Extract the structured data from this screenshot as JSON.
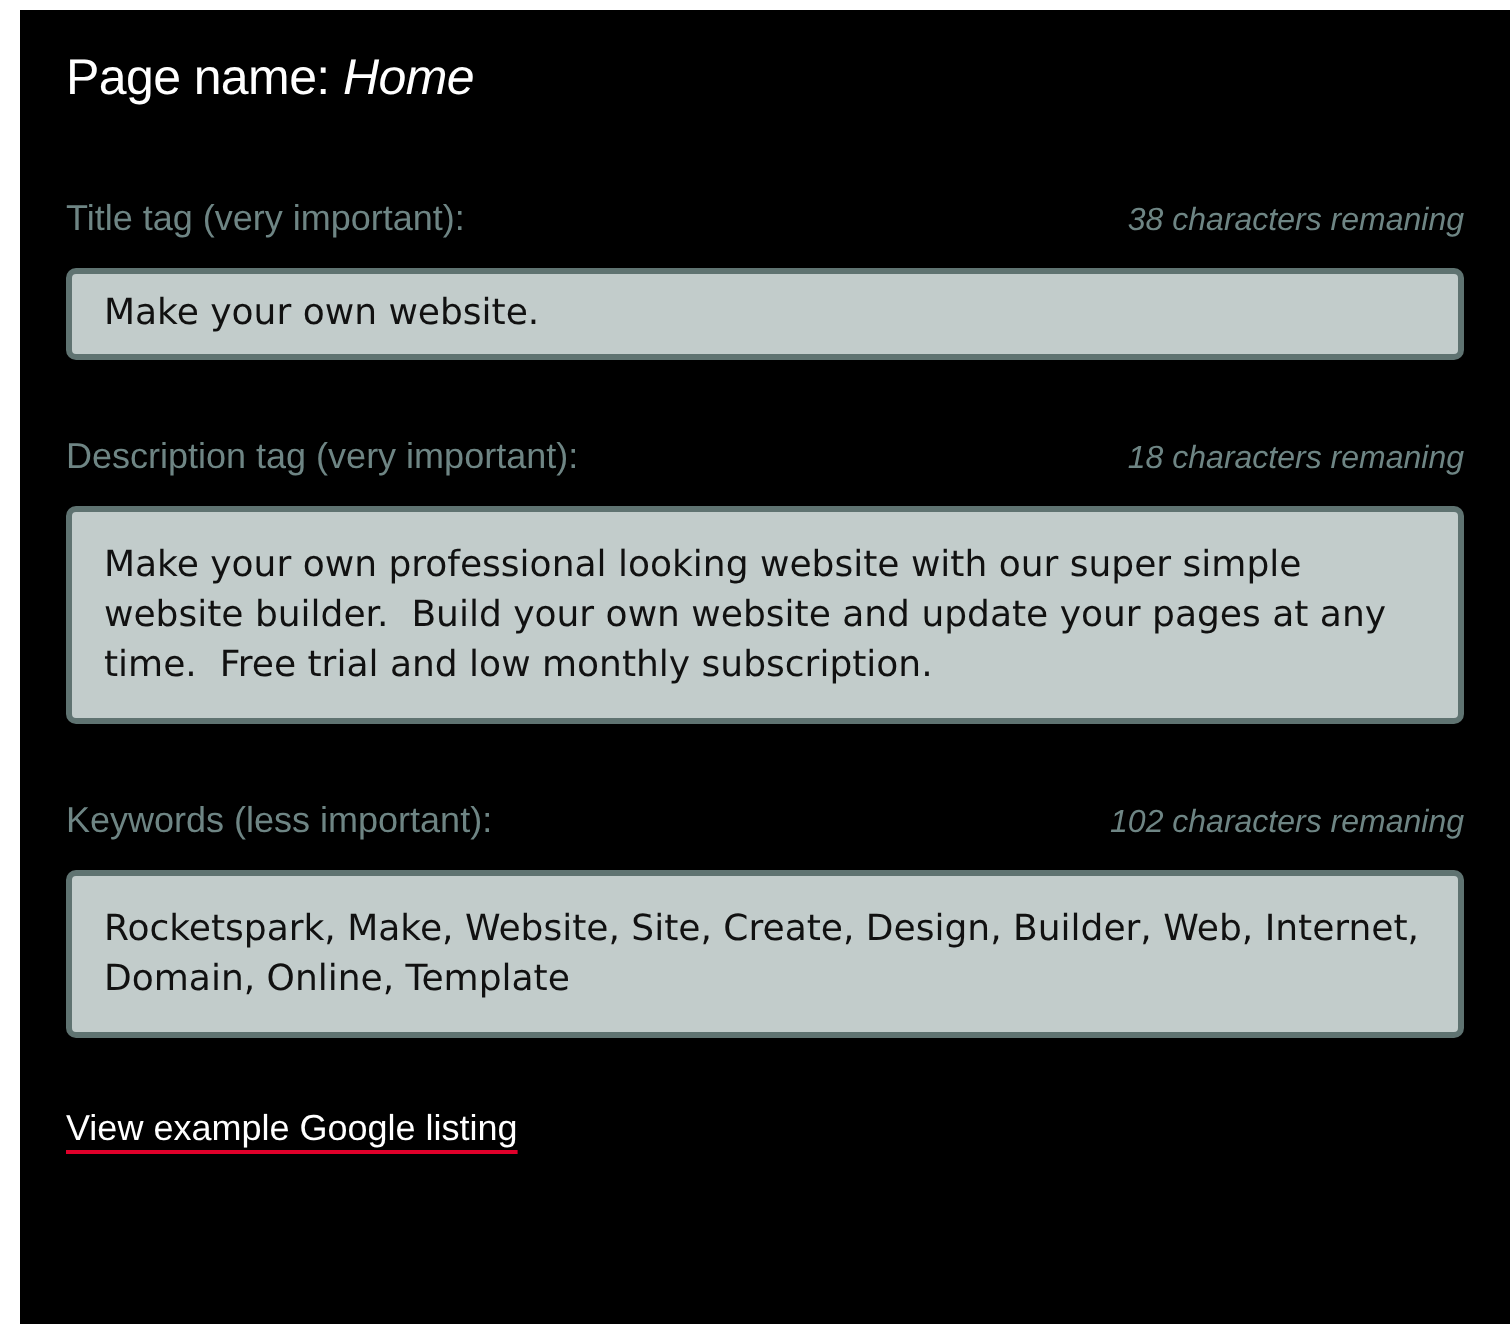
{
  "heading": "Page name: *Home*",
  "fields": [
    {
      "label": "Title tag (very important):",
      "counter": "38 characters remaning",
      "value": "Make your own website.",
      "kind": "single"
    },
    {
      "label": "Description tag (very important):",
      "counter": "18 characters remaning",
      "value": "Make your own professional looking website with our super simple website builder.  Build your own website and update your pages at any time.  Free trial and low monthly subscription.",
      "kind": "multi"
    },
    {
      "label": "Keywords (less important):",
      "counter": "102 characters remaning",
      "value": "Rocketspark, Make, Website, Site, Create, Design, Builder, Web, Internet, Domain, Online, Template",
      "kind": "multi"
    }
  ],
  "link": "View example Google listing"
}
